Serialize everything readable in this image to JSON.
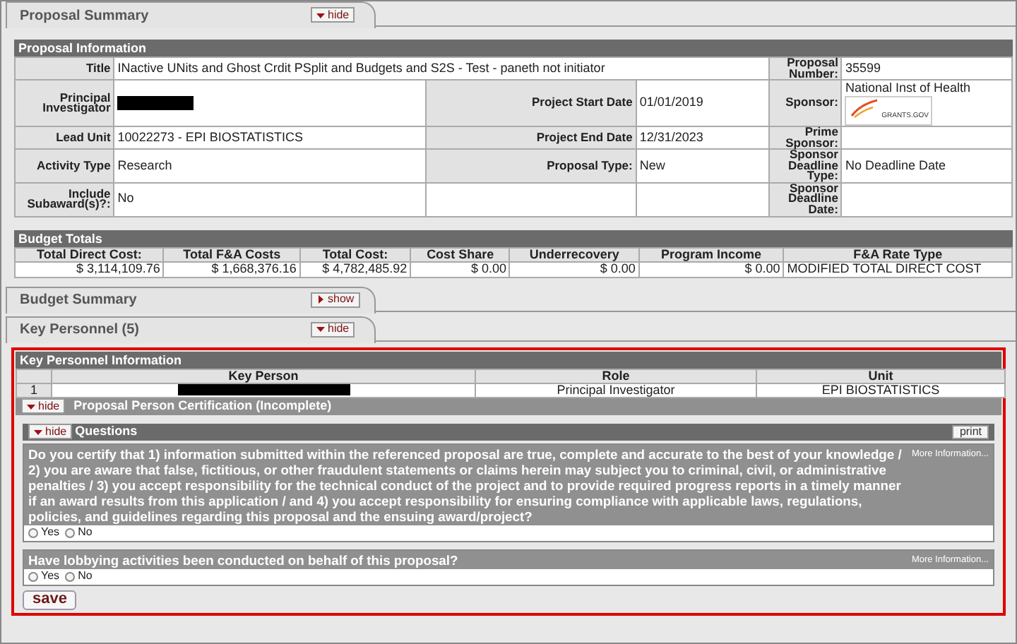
{
  "summary_tab": {
    "title": "Proposal Summary",
    "toggle": "hide",
    "expanded": true
  },
  "proposal_information": {
    "title": "Proposal Information",
    "rows": [
      [
        {
          "kind": "label",
          "text": "Title"
        },
        {
          "kind": "wide_value",
          "colspan": 3,
          "text": "INactive UNits and Ghost Crdit PSplit and Budgets and S2S - Test - paneth not initiator"
        },
        {
          "kind": "label",
          "text": "Proposal Number:"
        },
        {
          "kind": "value",
          "text": "35599"
        }
      ],
      [
        {
          "kind": "label",
          "text": "Principal Investigator"
        },
        {
          "kind": "redacted"
        },
        {
          "kind": "label",
          "text": "Project Start Date"
        },
        {
          "kind": "value",
          "text": "01/01/2019"
        },
        {
          "kind": "label",
          "text": "Sponsor:"
        },
        {
          "kind": "sponsor",
          "text": "National Inst of Health",
          "logo_text": "GRANTS.GOV"
        }
      ],
      [
        {
          "kind": "label",
          "text": "Lead Unit"
        },
        {
          "kind": "value",
          "text": "10022273 - EPI BIOSTATISTICS"
        },
        {
          "kind": "label",
          "text": "Project End Date"
        },
        {
          "kind": "value",
          "text": "12/31/2023"
        },
        {
          "kind": "label",
          "text": "Prime Sponsor:"
        },
        {
          "kind": "empty"
        }
      ],
      [
        {
          "kind": "label",
          "text": "Activity Type"
        },
        {
          "kind": "value",
          "text": "Research"
        },
        {
          "kind": "label",
          "text": "Proposal Type:"
        },
        {
          "kind": "value",
          "text": "New"
        },
        {
          "kind": "label",
          "text": "Sponsor Deadline Type:"
        },
        {
          "kind": "value",
          "text": "No Deadline Date"
        }
      ],
      [
        {
          "kind": "label",
          "text": "Include Subaward(s)?:"
        },
        {
          "kind": "value",
          "text": "No"
        },
        {
          "kind": "empty"
        },
        {
          "kind": "empty"
        },
        {
          "kind": "label",
          "text": "Sponsor Deadline Date:"
        },
        {
          "kind": "empty"
        }
      ]
    ]
  },
  "budget_totals": {
    "title": "Budget Totals",
    "columns": [
      "Total Direct Cost:",
      "Total F&A Costs",
      "Total Cost:",
      "Cost Share",
      "Underrecovery",
      "Program Income",
      "F&A Rate Type"
    ],
    "values": [
      "$ 3,114,109.76",
      "$ 1,668,376.16",
      "$ 4,782,485.92",
      "$ 0.00",
      "$ 0.00",
      "$ 0.00",
      "MODIFIED TOTAL DIRECT COST"
    ]
  },
  "tabs": [
    {
      "title": "Budget Summary",
      "toggle": "show",
      "expanded": false
    },
    {
      "title": "Key Personnel (5)",
      "toggle": "hide",
      "expanded": true
    }
  ],
  "key_personnel": {
    "title": "Key Personnel Information",
    "columns": [
      "Key Person",
      "Role",
      "Unit"
    ],
    "rows": [
      {
        "number": "1",
        "cells": [
          {
            "kind": "redacted"
          },
          {
            "kind": "value",
            "text": "Principal Investigator"
          },
          {
            "kind": "value",
            "text": "EPI BIOSTATISTICS"
          }
        ]
      }
    ],
    "certification": {
      "toggle": "hide",
      "expanded": true,
      "title": "Proposal Person Certification (Incomplete)",
      "questions_section": {
        "toggle": "hide",
        "expanded": true,
        "title": "Questions",
        "print": "print",
        "questions": [
          {
            "text": "Do you certify that 1) information submitted within the referenced proposal are true, complete and accurate to the best of your knowledge / 2) you are aware that false, fictitious, or other fraudulent statements or claims herein may subject you to criminal, civil, or administrative penalties / 3) you accept responsibility for the technical conduct of the project and to provide required progress reports in a timely manner if an award results from this application / and 4) you accept responsibility for ensuring compliance with applicable laws, regulations, policies, and guidelines regarding this proposal and the ensuing award/project?",
            "more": "More Information...",
            "options": [
              {
                "label": "Yes",
                "selected": false
              },
              {
                "label": "No",
                "selected": false
              }
            ]
          },
          {
            "text": "Have lobbying activities been conducted on behalf of this proposal?",
            "more": "More Information...",
            "options": [
              {
                "label": "Yes",
                "selected": false
              },
              {
                "label": "No",
                "selected": false
              }
            ]
          }
        ]
      }
    },
    "save": "save"
  }
}
